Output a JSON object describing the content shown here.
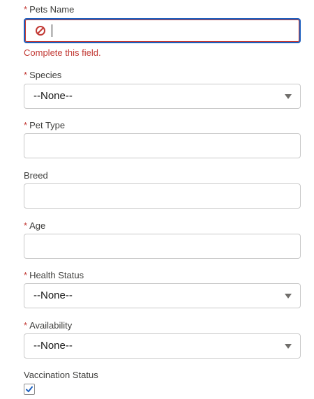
{
  "form": {
    "pets_name": {
      "label": "Pets Name",
      "required_marker": "*",
      "value": "",
      "error": "Complete this field.",
      "error_icon": "prohibited-icon"
    },
    "species": {
      "label": "Species",
      "required_marker": "*",
      "value": "--None--"
    },
    "pet_type": {
      "label": "Pet Type",
      "required_marker": "*",
      "value": ""
    },
    "breed": {
      "label": "Breed",
      "value": ""
    },
    "age": {
      "label": "Age",
      "required_marker": "*",
      "value": ""
    },
    "health_status": {
      "label": "Health Status",
      "required_marker": "*",
      "value": "--None--"
    },
    "availability": {
      "label": "Availability",
      "required_marker": "*",
      "value": "--None--"
    },
    "vaccination_status": {
      "label": "Vaccination Status",
      "checked": true
    }
  },
  "colors": {
    "required": "#c23934",
    "error_text": "#c23934",
    "focus_border": "#1b5fbf",
    "checkmark": "#1b5fbf"
  }
}
